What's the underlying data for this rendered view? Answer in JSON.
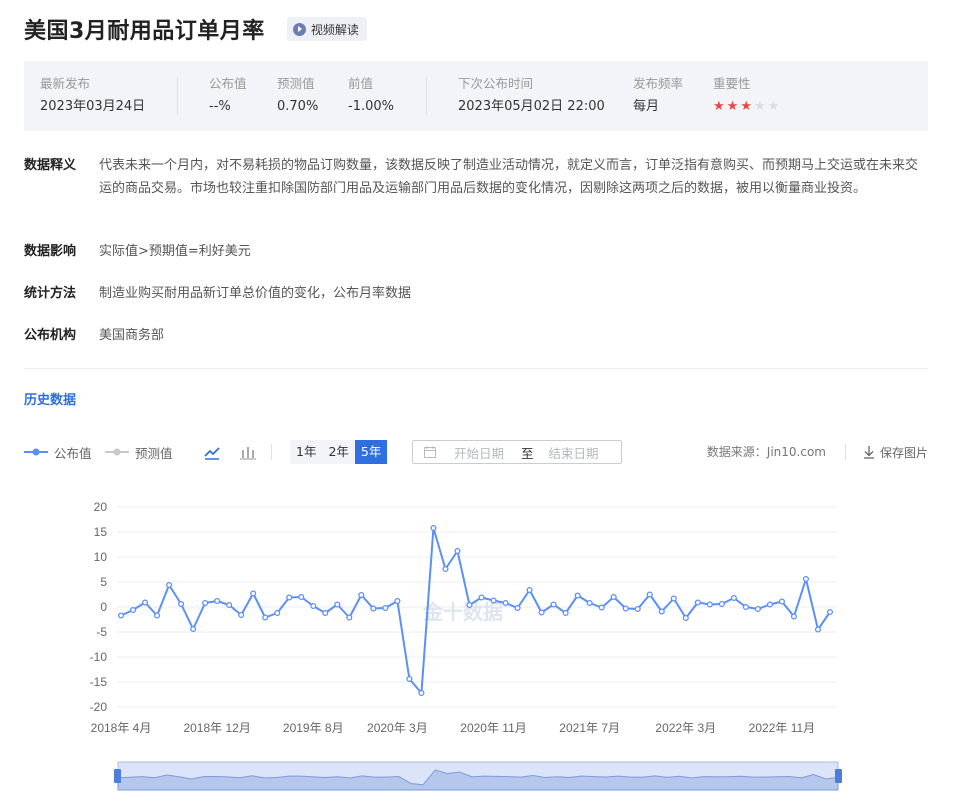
{
  "header": {
    "title": "美国3月耐用品订单月率",
    "video_label": "视频解读"
  },
  "info": {
    "latest_label": "最新发布",
    "latest_value": "2023年03月24日",
    "actual_label": "公布值",
    "actual_value": "--%",
    "forecast_label": "预测值",
    "forecast_value": "0.70%",
    "previous_label": "前值",
    "previous_value": "-1.00%",
    "next_label": "下次公布时间",
    "next_value": "2023年05月02日 22:00",
    "freq_label": "发布频率",
    "freq_value": "每月",
    "importance_label": "重要性",
    "importance_stars": 3,
    "importance_max": 5
  },
  "description": [
    {
      "label": "数据释义",
      "text": "代表未来一个月内，对不易耗损的物品订购数量，该数据反映了制造业活动情况，就定义而言，订单泛指有意购买、而预期马上交运或在未来交运的商品交易。市场也较注重扣除国防部门用品及运输部门用品后数据的变化情况，因剔除这两项之后的数据，被用以衡量商业投资。"
    },
    {
      "label": "数据影响",
      "text": "实际值>预期值=利好美元"
    },
    {
      "label": "统计方法",
      "text": "制造业购买耐用品新订单总价值的变化，公布月率数据"
    },
    {
      "label": "公布机构",
      "text": "美国商务部"
    }
  ],
  "history": {
    "title": "历史数据",
    "legend_actual": "公布值",
    "legend_forecast": "预测值",
    "ranges": [
      "1年",
      "2年",
      "5年"
    ],
    "active_range": "5年",
    "start_placeholder": "开始日期",
    "range_sep": "至",
    "end_placeholder": "结束日期",
    "source": "数据来源：Jin10.com",
    "save_label": "保存图片",
    "watermark": "金十数据"
  },
  "colors": {
    "accent": "#2f6fe0",
    "line": "#5b8ff9",
    "star_on": "#e8474a",
    "star_off": "#dcdcdc"
  },
  "chart_data": {
    "type": "line",
    "ylim": [
      -20,
      20
    ],
    "yticks": [
      20,
      15,
      10,
      5,
      0,
      -5,
      -10,
      -15,
      -20
    ],
    "xtick_labels": [
      {
        "label": "2018年 4月",
        "index": 0
      },
      {
        "label": "2018年 12月",
        "index": 8
      },
      {
        "label": "2019年 8月",
        "index": 16
      },
      {
        "label": "2020年 3月",
        "index": 23
      },
      {
        "label": "2020年 11月",
        "index": 31
      },
      {
        "label": "2021年 7月",
        "index": 39
      },
      {
        "label": "2022年 3月",
        "index": 47
      },
      {
        "label": "2022年 11月",
        "index": 55
      }
    ],
    "series": [
      {
        "values": [
          -1.7,
          -0.6,
          0.9,
          -1.7,
          4.4,
          0.6,
          -4.4,
          0.8,
          1.2,
          0.4,
          -1.6,
          2.7,
          -2.1,
          -1.2,
          1.9,
          2.0,
          0.2,
          -1.2,
          0.5,
          -2.1,
          2.4,
          -0.3,
          -0.2,
          1.2,
          -14.4,
          -17.2,
          15.8,
          7.6,
          11.2,
          0.4,
          1.9,
          1.3,
          0.8,
          -0.2,
          3.4,
          -1.1,
          0.5,
          -1.2,
          2.3,
          0.8,
          -0.1,
          2.0,
          -0.3,
          -0.4,
          2.5,
          -0.9,
          1.7,
          -2.2,
          0.9,
          0.5,
          0.6,
          1.8,
          0.0,
          -0.4,
          0.5,
          1.1,
          -1.9,
          5.6,
          -4.5,
          -1.0
        ]
      }
    ]
  }
}
